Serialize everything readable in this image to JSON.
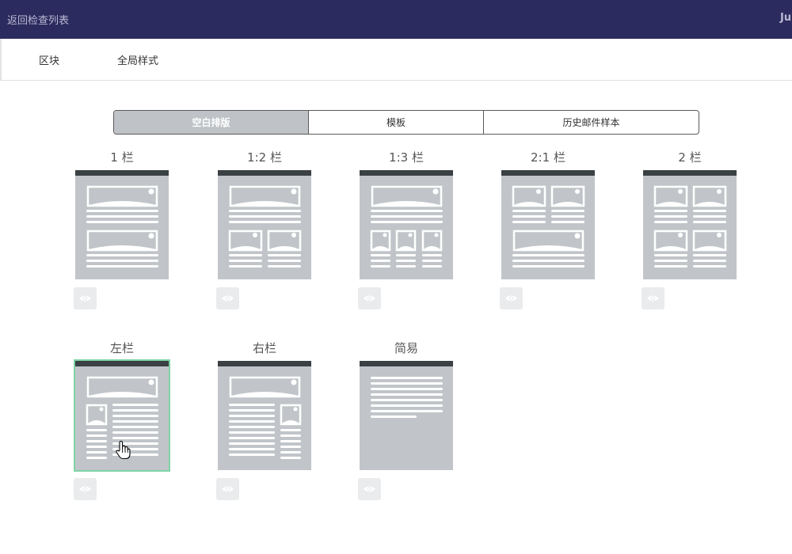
{
  "topbar": {
    "back_label": "返回检查列表",
    "user_label": "Ju"
  },
  "subnav": {
    "tabs": [
      {
        "label": "区块"
      },
      {
        "label": "全局样式"
      }
    ]
  },
  "segmented": {
    "options": [
      {
        "label": "空白排版",
        "active": true
      },
      {
        "label": "模板",
        "active": false
      },
      {
        "label": "历史邮件样本",
        "active": false
      }
    ]
  },
  "layouts": [
    {
      "title": "1 栏"
    },
    {
      "title": "1:2 栏"
    },
    {
      "title": "1:3 栏"
    },
    {
      "title": "2:1 栏"
    },
    {
      "title": "2 栏"
    },
    {
      "title": "左栏",
      "selected": true
    },
    {
      "title": "右栏"
    },
    {
      "title": "简易"
    }
  ],
  "icons": {
    "preview": "eye-icon",
    "cursor": "hand-pointer-icon"
  },
  "colors": {
    "topbar": "#2c2b5f",
    "thumbnail": "#c1c5c9",
    "selected_border": "#7fd3a6",
    "active_segment": "#bfc3c7"
  }
}
